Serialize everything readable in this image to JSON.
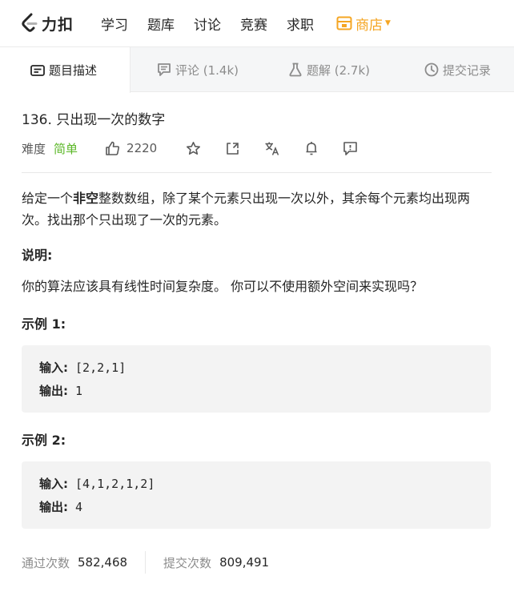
{
  "brand": {
    "name": "力扣",
    "accent": "#f5a623"
  },
  "nav": {
    "items": [
      {
        "label": "学习"
      },
      {
        "label": "题库"
      },
      {
        "label": "讨论"
      },
      {
        "label": "竞赛"
      },
      {
        "label": "求职"
      }
    ],
    "shop_label": "商店"
  },
  "tabs": [
    {
      "label": "题目描述",
      "icon": "description-icon",
      "active": true
    },
    {
      "label": "评论 (1.4k)",
      "icon": "comment-icon"
    },
    {
      "label": "题解 (2.7k)",
      "icon": "flask-icon"
    },
    {
      "label": "提交记录",
      "icon": "clock-icon"
    }
  ],
  "problem": {
    "title": "136. 只出现一次的数字",
    "difficulty_label": "难度",
    "difficulty": "简单",
    "difficulty_color": "#5ab726",
    "likes": "2220",
    "desc_pre": "给定一个",
    "desc_bold": "非空",
    "desc_post": "整数数组，除了某个元素只出现一次以外，其余每个元素均出现两次。找出那个只出现了一次的元素。",
    "note_heading": "说明:",
    "note_text": "你的算法应该具有线性时间复杂度。 你可以不使用额外空间来实现吗？",
    "examples": [
      {
        "heading": "示例 1:",
        "input_label": "输入:",
        "input": "[2,2,1]",
        "output_label": "输出:",
        "output": "1"
      },
      {
        "heading": "示例 2:",
        "input_label": "输入:",
        "input": "[4,1,2,1,2]",
        "output_label": "输出:",
        "output": "4"
      }
    ]
  },
  "stats": {
    "accepted_label": "通过次数",
    "accepted": "582,468",
    "submitted_label": "提交次数",
    "submitted": "809,491"
  }
}
